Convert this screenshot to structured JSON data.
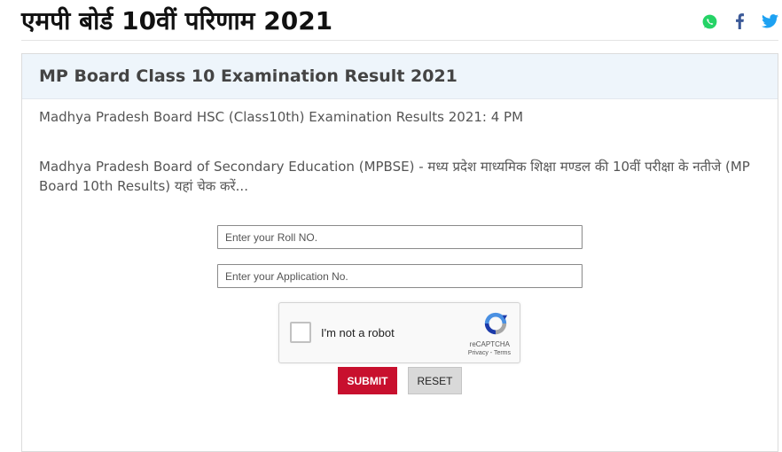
{
  "header": {
    "title": "एमपी बोर्ड 10वीं परिणाम 2021",
    "share_icons": [
      {
        "icon": "whatsapp-icon",
        "color": "#25D366"
      },
      {
        "icon": "facebook-icon",
        "color": "#3b5998"
      },
      {
        "icon": "twitter-icon",
        "color": "#1DA1F2"
      }
    ]
  },
  "card": {
    "title": "MP Board Class 10 Examination Result 2021",
    "line1": "Madhya Pradesh Board HSC (Class10th) Examination Results 2021: 4 PM",
    "line2": "Madhya Pradesh Board of Secondary Education (MPBSE) - मध्य प्रदेश माध्यमिक शिक्षा मण्डल की 10वीं परीक्षा के नतीजे (MP Board 10th Results) यहां चेक करें..."
  },
  "form": {
    "roll_placeholder": "Enter your Roll NO.",
    "application_placeholder": "Enter your Application No.",
    "captcha": {
      "label": "I'm not a robot",
      "brand": "reCAPTCHA",
      "privacy": "Privacy",
      "separator": " - ",
      "terms": "Terms"
    },
    "submit_label": "SUBMIT",
    "reset_label": "RESET"
  },
  "colors": {
    "accent": "#c8102e",
    "card_header_bg": "#eef5fb"
  }
}
